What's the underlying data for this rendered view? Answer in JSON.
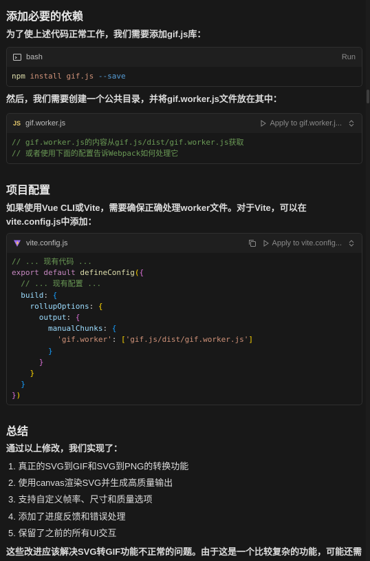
{
  "section1": {
    "heading": "添加必要的依赖",
    "intro": "为了使上述代码正常工作，我们需要添加gif.js库："
  },
  "bash_block": {
    "lang": "bash",
    "run_label": "Run",
    "cmd_npm": "npm",
    "cmd_install": "install",
    "cmd_pkg": "gif.js",
    "cmd_flag": "--save"
  },
  "section1b": {
    "text": "然后，我们需要创建一个公共目录，并将gif.worker.js文件放在其中："
  },
  "worker_block": {
    "lang_badge": "JS",
    "filename": "gif.worker.js",
    "apply_label": "Apply to gif.worker.j...",
    "lines": [
      "// gif.worker.js的内容从gif.js/dist/gif.worker.js获取",
      "// 或者使用下面的配置告诉Webpack如何处理它"
    ]
  },
  "section2": {
    "heading": "项目配置",
    "text": "如果使用Vue CLI或Vite，需要确保正确处理worker文件。对于Vite，可以在vite.config.js中添加："
  },
  "vite_block": {
    "filename": "vite.config.js",
    "apply_label": "Apply to vite.config...",
    "comment1": "// ... 现有代码 ...",
    "export": "export",
    "default": "default",
    "fn": "defineConfig",
    "comment2": "// ... 现有配置 ...",
    "build": "build",
    "rollupOptions": "rollupOptions",
    "output": "output",
    "manualChunks": "manualChunks",
    "key": "'gif.worker'",
    "value": "'gif.js/dist/gif.worker.js'"
  },
  "section3": {
    "heading": "总结",
    "intro": "通过以上修改，我们实现了：",
    "items": [
      "1. 真正的SVG到GIF和SVG到PNG的转换功能",
      "2. 使用canvas渲染SVG并生成高质量输出",
      "3. 支持自定义帧率、尺寸和质量选项",
      "4. 添加了进度反馈和错误处理",
      "5. 保留了之前的所有UI交互"
    ],
    "footer": "这些改进应该解决SVG转GIF功能不正常的问题。由于这是一个比较复杂的功能，可能还需"
  }
}
